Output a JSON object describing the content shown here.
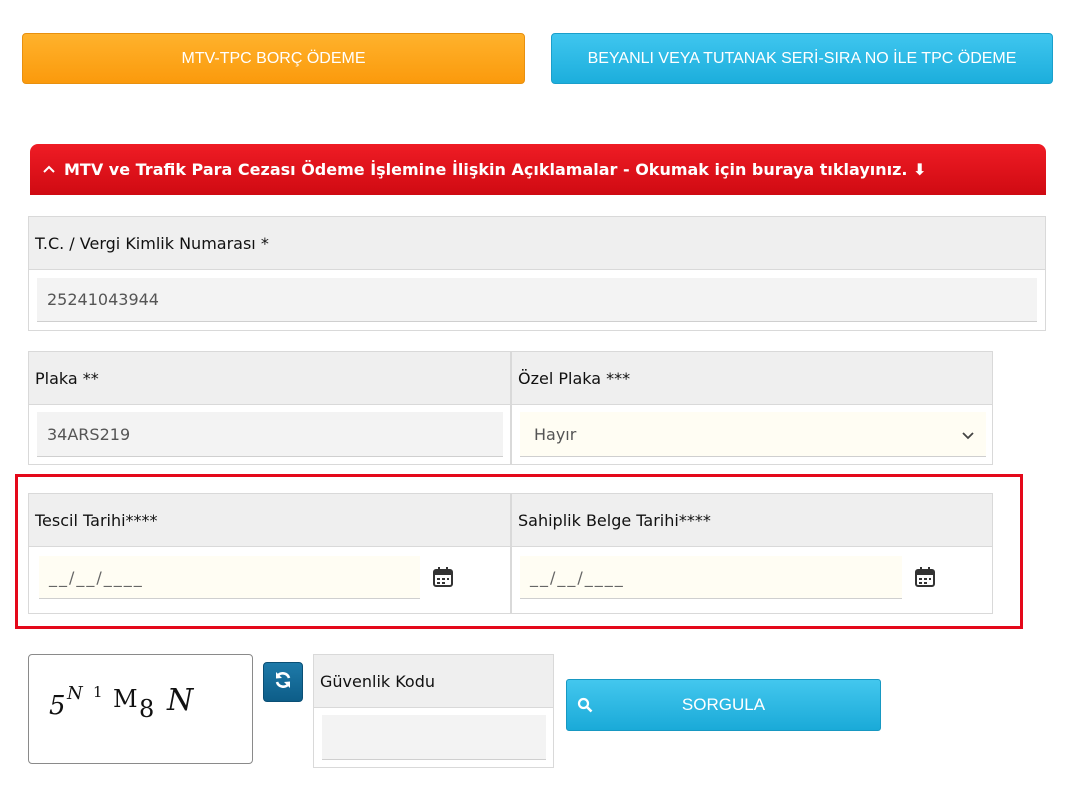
{
  "top_buttons": {
    "mtv_tpc": "MTV-TPC BORÇ ÖDEME",
    "beyanli": "BEYANLI VEYA TUTANAK SERİ-SIRA NO İLE TPC ÖDEME"
  },
  "info_bar": {
    "text": "MTV ve Trafik Para Cezası Ödeme İşlemine İlişkin Açıklamalar - Okumak için buraya tıklayınız. ⬇"
  },
  "tc_panel": {
    "label": "T.C. / Vergi Kimlik Numarası *",
    "value": "25241043944"
  },
  "plaka_panel": {
    "label": "Plaka **",
    "value": "34ARS219"
  },
  "ozel_plaka_panel": {
    "label": "Özel Plaka ***",
    "selected": "Hayır"
  },
  "tescil_panel": {
    "label": "Tescil Tarihi****",
    "placeholder": "__/__/____"
  },
  "sahiplik_panel": {
    "label": "Sahiplik Belge Tarihi****",
    "placeholder": "__/__/____"
  },
  "captcha": {
    "chars": [
      "5",
      "N",
      "1",
      "M",
      "8",
      "N"
    ]
  },
  "guvenlik_panel": {
    "label": "Güvenlik Kodu",
    "value": ""
  },
  "search_button": {
    "label": "SORGULA"
  },
  "icons": {
    "calendar": "calendar-icon",
    "refresh": "refresh-icon",
    "search": "search-icon",
    "chevron_up": "chevron-up-icon",
    "chevron_down": "chevron-down-icon"
  },
  "colors": {
    "orange": "#fb9a0c",
    "blue": "#1caedc",
    "red": "#e4081a",
    "refresh_blue": "#0d5d88"
  }
}
